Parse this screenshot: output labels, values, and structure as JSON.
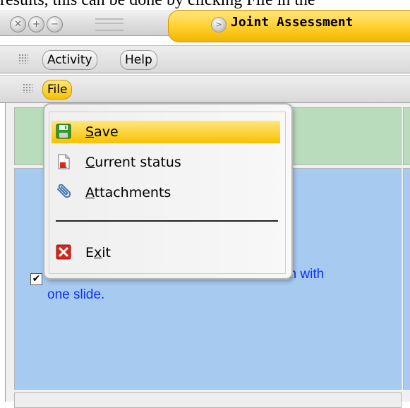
{
  "document": {
    "top_text": "results, this can be done by clicking File in the"
  },
  "window": {
    "title": "Joint Assessment",
    "controls": [
      "close",
      "maximize",
      "minimize"
    ]
  },
  "menubar": {
    "items": [
      {
        "label": "Activity"
      },
      {
        "label": "Help"
      }
    ]
  },
  "toolbar": {
    "file_label": "File"
  },
  "file_menu": {
    "items": [
      {
        "label": "Save",
        "mnemonic": "S",
        "rest": "ave",
        "icon": "floppy-disk-icon",
        "highlighted": true
      },
      {
        "label": "Current status",
        "mnemonic": "C",
        "rest": "urrent status",
        "icon": "document-status-icon",
        "highlighted": false
      },
      {
        "label": "Attachments",
        "mnemonic": "A",
        "rest": "ttachments",
        "icon": "paperclip-icon",
        "highlighted": false
      },
      {
        "label": "Exit",
        "pre": "E",
        "mnemonic": "x",
        "rest": "it",
        "icon": "red-x-icon",
        "highlighted": false
      }
    ]
  },
  "content": {
    "visible_text": "on with one slide.",
    "text_line1": "on with",
    "text_line2": "one slide.",
    "checkbox_checked": true
  },
  "colors": {
    "accent_yellow": "#f7c200",
    "header_green": "#b9dcbc",
    "cell_blue": "#a6caf0",
    "link_blue": "#1030ff"
  }
}
